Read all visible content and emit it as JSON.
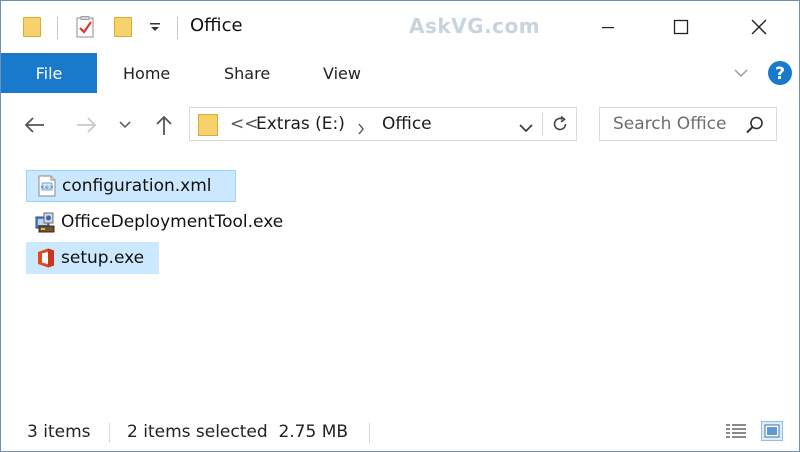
{
  "window": {
    "title": "Office",
    "watermark": "AskVG.com"
  },
  "ribbon": {
    "tabs": [
      {
        "label": "File"
      },
      {
        "label": "Home"
      },
      {
        "label": "Share"
      },
      {
        "label": "View"
      }
    ]
  },
  "address": {
    "overflow": "<<",
    "breadcrumb": [
      {
        "label": "Extras (E:)"
      },
      {
        "label": "Office"
      }
    ]
  },
  "search": {
    "placeholder": "Search Office"
  },
  "files": [
    {
      "name": "configuration.xml",
      "icon": "xml-file-icon",
      "selected": true
    },
    {
      "name": "OfficeDeploymentTool.exe",
      "icon": "installer-exe-icon",
      "selected": false
    },
    {
      "name": "setup.exe",
      "icon": "office-logo-icon",
      "selected": true
    }
  ],
  "status": {
    "item_count": "3 items",
    "selected_info": "2 items selected  2.75 MB"
  },
  "colors": {
    "accent": "#1979ca",
    "selection": "#cce8ff",
    "selection_border": "#99d1ff",
    "folder": "#f5d26b"
  }
}
